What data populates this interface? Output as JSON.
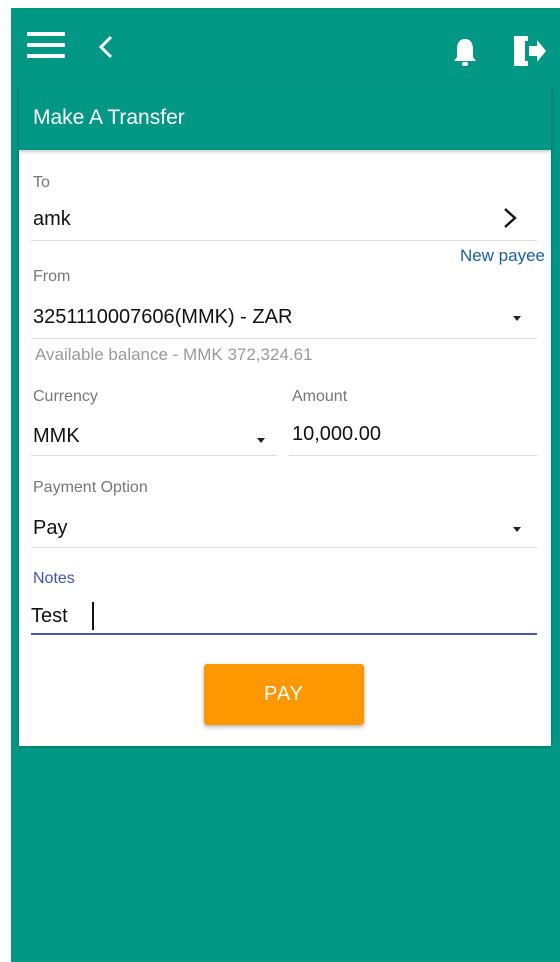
{
  "header": {
    "menu_icon": "hamburger-menu-icon",
    "back_icon": "chevron-left-icon",
    "notification_icon": "bell-icon",
    "logout_icon": "logout-icon"
  },
  "card": {
    "title": "Make A Transfer"
  },
  "form": {
    "to": {
      "label": "To",
      "value": "amk",
      "chevron_icon": "chevron-right-icon"
    },
    "new_payee_link": "New payee",
    "from": {
      "label": "From",
      "value": "3251110007606(MMK) - ZAR",
      "hint": "Available balance - MMK 372,324.61"
    },
    "currency": {
      "label": "Currency",
      "value": "MMK"
    },
    "amount": {
      "label": "Amount",
      "value": "10,000.00"
    },
    "payment_option": {
      "label": "Payment Option",
      "value": "Pay"
    },
    "notes": {
      "label": "Notes",
      "value": "Test"
    },
    "pay_button": "PAY"
  },
  "colors": {
    "primary": "#009885",
    "accent": "#ff9800",
    "focus_underline": "#4a55b8",
    "link": "#1a5fa8"
  }
}
